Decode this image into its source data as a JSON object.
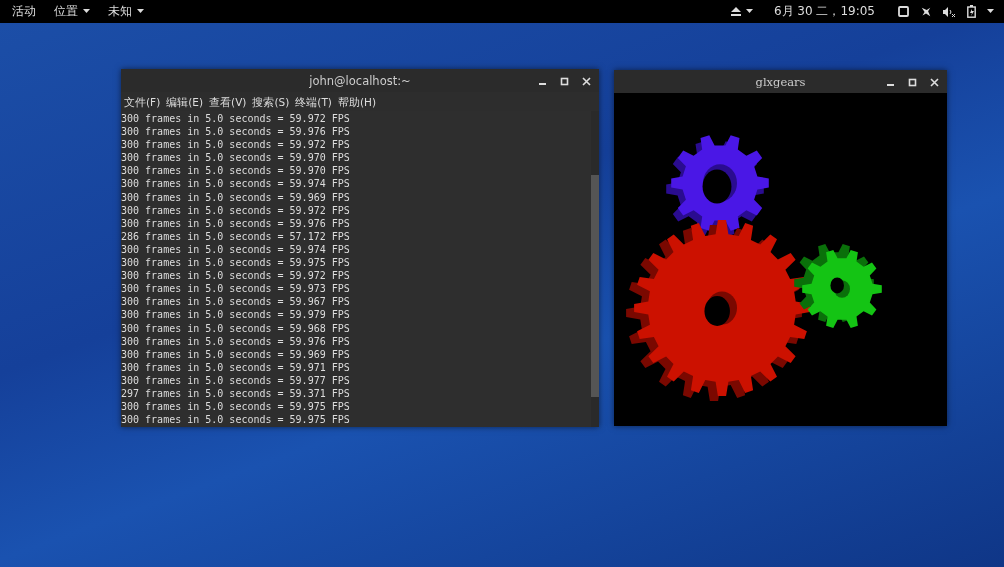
{
  "top_bar": {
    "activities": "活动",
    "menus": [
      {
        "label": "位置"
      },
      {
        "label": "未知"
      }
    ],
    "clock": "6月 30 二，19:05"
  },
  "terminal": {
    "title": "john@localhost:~",
    "menu": [
      "文件(F)",
      "编辑(E)",
      "查看(V)",
      "搜索(S)",
      "终端(T)",
      "帮助(H)"
    ],
    "lines": [
      "300 frames in 5.0 seconds = 59.972 FPS",
      "300 frames in 5.0 seconds = 59.976 FPS",
      "300 frames in 5.0 seconds = 59.972 FPS",
      "300 frames in 5.0 seconds = 59.970 FPS",
      "300 frames in 5.0 seconds = 59.970 FPS",
      "300 frames in 5.0 seconds = 59.974 FPS",
      "300 frames in 5.0 seconds = 59.969 FPS",
      "300 frames in 5.0 seconds = 59.972 FPS",
      "300 frames in 5.0 seconds = 59.976 FPS",
      "286 frames in 5.0 seconds = 57.172 FPS",
      "300 frames in 5.0 seconds = 59.974 FPS",
      "300 frames in 5.0 seconds = 59.975 FPS",
      "300 frames in 5.0 seconds = 59.972 FPS",
      "300 frames in 5.0 seconds = 59.973 FPS",
      "300 frames in 5.0 seconds = 59.967 FPS",
      "300 frames in 5.0 seconds = 59.979 FPS",
      "300 frames in 5.0 seconds = 59.968 FPS",
      "300 frames in 5.0 seconds = 59.976 FPS",
      "300 frames in 5.0 seconds = 59.969 FPS",
      "300 frames in 5.0 seconds = 59.971 FPS",
      "300 frames in 5.0 seconds = 59.977 FPS",
      "297 frames in 5.0 seconds = 59.371 FPS",
      "300 frames in 5.0 seconds = 59.975 FPS",
      "300 frames in 5.0 seconds = 59.975 FPS"
    ]
  },
  "gears_window": {
    "title": "glxgears"
  }
}
